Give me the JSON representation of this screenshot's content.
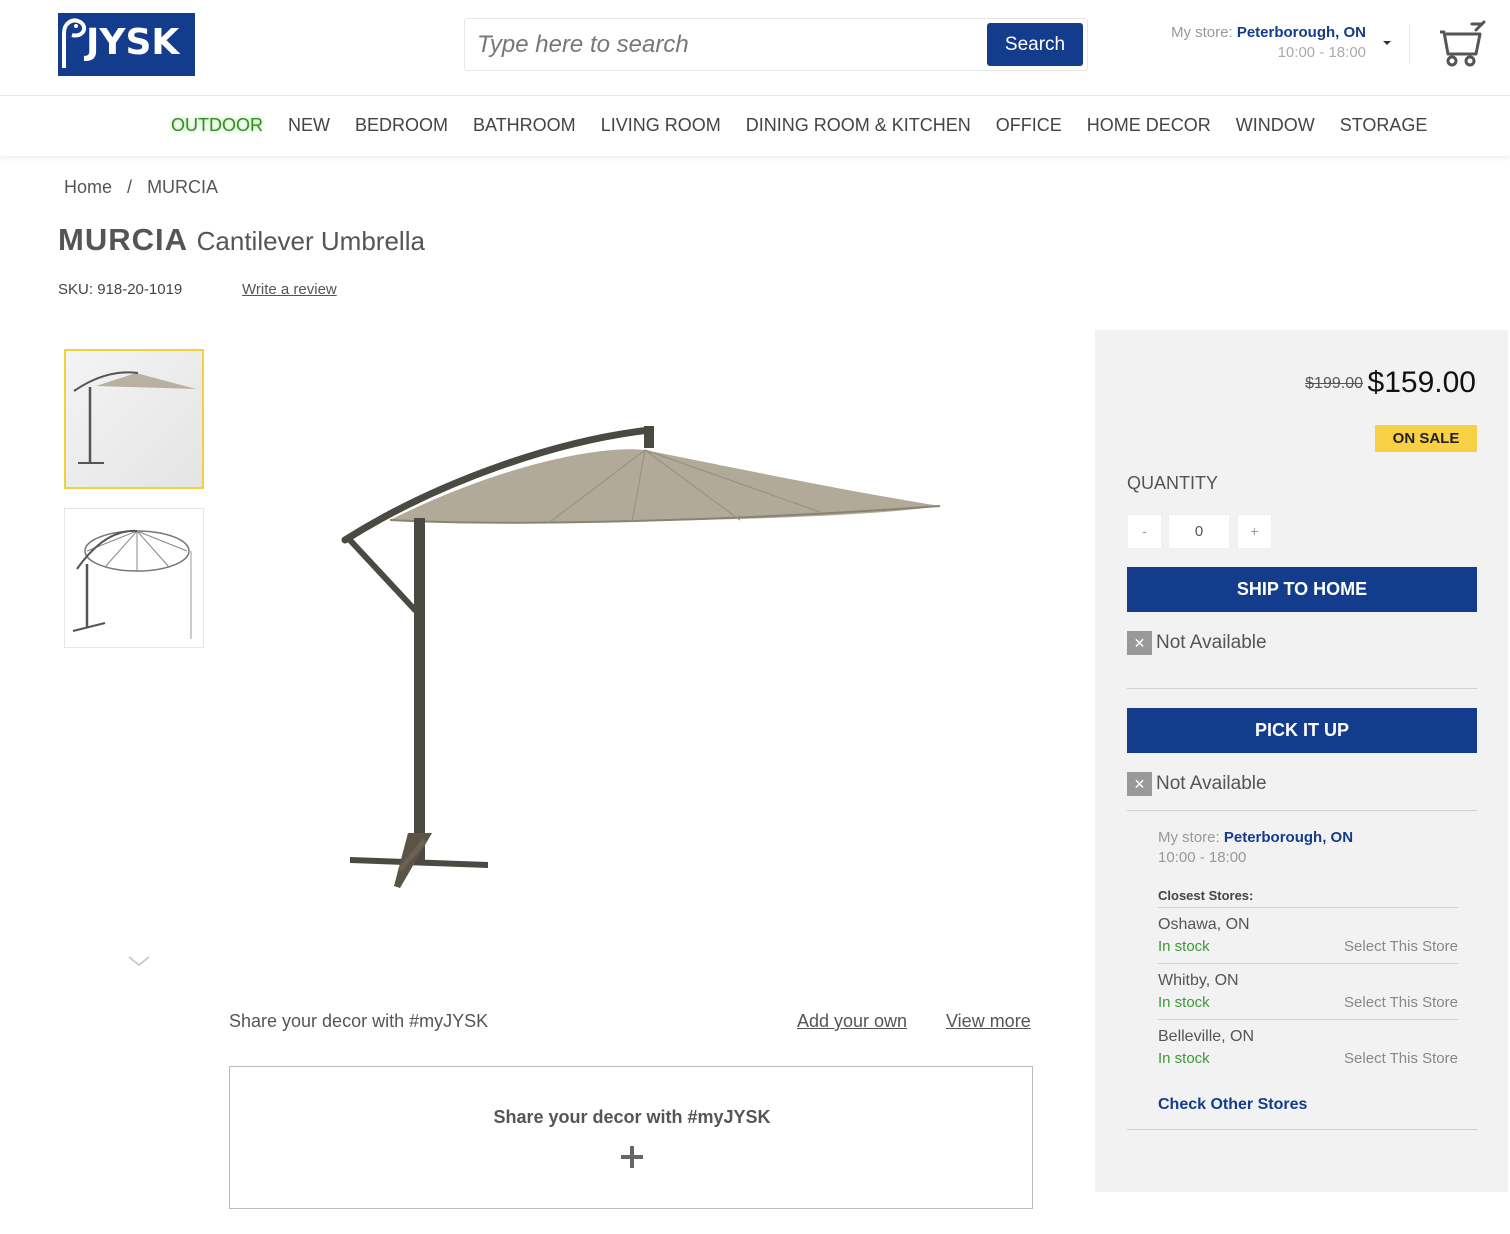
{
  "header": {
    "logo_text": "JYSK",
    "search": {
      "placeholder": "Type here to search",
      "button_label": "Search"
    },
    "store": {
      "label": "My store:",
      "name": "Peterborough, ON",
      "hours": "10:00 - 18:00"
    }
  },
  "nav": {
    "items": [
      "OUTDOOR",
      "NEW",
      "BEDROOM",
      "BATHROOM",
      "LIVING ROOM",
      "DINING ROOM & KITCHEN",
      "OFFICE",
      "HOME DECOR",
      "WINDOW",
      "STORAGE"
    ]
  },
  "breadcrumb": {
    "home": "Home",
    "separator": "/",
    "current": "MURCIA"
  },
  "product": {
    "brand": "MURCIA",
    "name": "Cantilever Umbrella",
    "sku_label": "SKU:",
    "sku": "918-20-1019",
    "review_link": "Write a review"
  },
  "share": {
    "text": "Share your decor with #myJYSK",
    "add_own": "Add your own",
    "view_more": "View more",
    "box_title": "Share your decor with #myJYSK"
  },
  "purchase": {
    "old_price": "$199.00",
    "price": "$159.00",
    "badge": "ON SALE",
    "quantity_label": "QUANTITY",
    "quantity_minus": "-",
    "quantity_value": "0",
    "quantity_plus": "+",
    "ship_button": "SHIP TO HOME",
    "ship_status": "Not Available",
    "pick_button": "PICK IT UP",
    "pick_status": "Not Available",
    "store_label": "My store:",
    "store_name": "Peterborough, ON",
    "store_hours": "10:00 - 18:00",
    "closest_label": "Closest Stores:",
    "closest_stores": [
      {
        "city": "Oshawa, ON",
        "stock": "In stock",
        "select": "Select This Store"
      },
      {
        "city": "Whitby, ON",
        "stock": "In stock",
        "select": "Select This Store"
      },
      {
        "city": "Belleville, ON",
        "stock": "In stock",
        "select": "Select This Store"
      }
    ],
    "check_other": "Check Other Stores"
  },
  "colors": {
    "brand_blue": "#143c8c",
    "sale_yellow": "#f7d046",
    "in_stock_green": "#3a9a3a"
  }
}
